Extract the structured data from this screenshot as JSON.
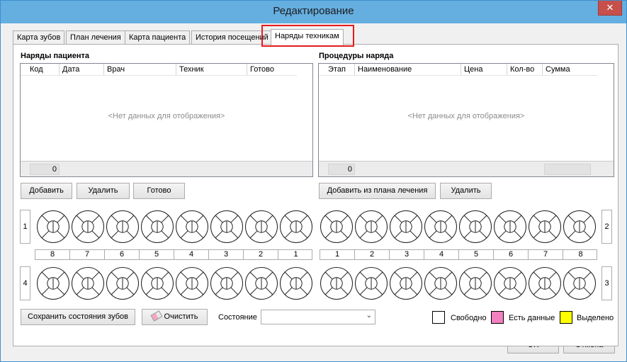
{
  "window": {
    "title": "Редактирование",
    "close_glyph": "✕"
  },
  "tabs": [
    {
      "label": "Карта зубов"
    },
    {
      "label": "План лечения"
    },
    {
      "label": "Карта пациента"
    },
    {
      "label": "История посещений"
    },
    {
      "label": "Наряды техникам"
    }
  ],
  "orders": {
    "title": "Наряды пациента",
    "columns": [
      "Код",
      "Дата",
      "Врач",
      "Техник",
      "Готово"
    ],
    "empty_text": "<Нет данных для отображения>",
    "count": "0",
    "buttons": {
      "add": "Добавить",
      "delete": "Удалить",
      "done": "Готово"
    }
  },
  "procedures": {
    "title": "Процедуры наряда",
    "columns": [
      "Этап",
      "Наименование",
      "Цена",
      "Кол-во",
      "Сумма"
    ],
    "empty_text": "<Нет данных для отображения>",
    "count": "0",
    "buttons": {
      "add_from_plan": "Добавить из плана лечения",
      "delete": "Удалить"
    }
  },
  "teeth": {
    "quadrant_labels": {
      "upper_left": "1",
      "upper_right": "2",
      "lower_right": "3",
      "lower_left": "4"
    },
    "left_numbers": [
      "8",
      "7",
      "6",
      "5",
      "4",
      "3",
      "2",
      "1"
    ],
    "right_numbers": [
      "1",
      "2",
      "3",
      "4",
      "5",
      "6",
      "7",
      "8"
    ]
  },
  "bottom": {
    "save_states": "Сохранить состояния зубов",
    "clear": "Очистить",
    "state_label": "Состояние",
    "state_value": "",
    "legend": [
      {
        "label": "Свободно",
        "color": "#ffffff"
      },
      {
        "label": "Есть данные",
        "color": "#f27fbf"
      },
      {
        "label": "Выделено",
        "color": "#ffff00"
      }
    ]
  },
  "dialog": {
    "ok": "OK",
    "cancel": "Отмена"
  }
}
